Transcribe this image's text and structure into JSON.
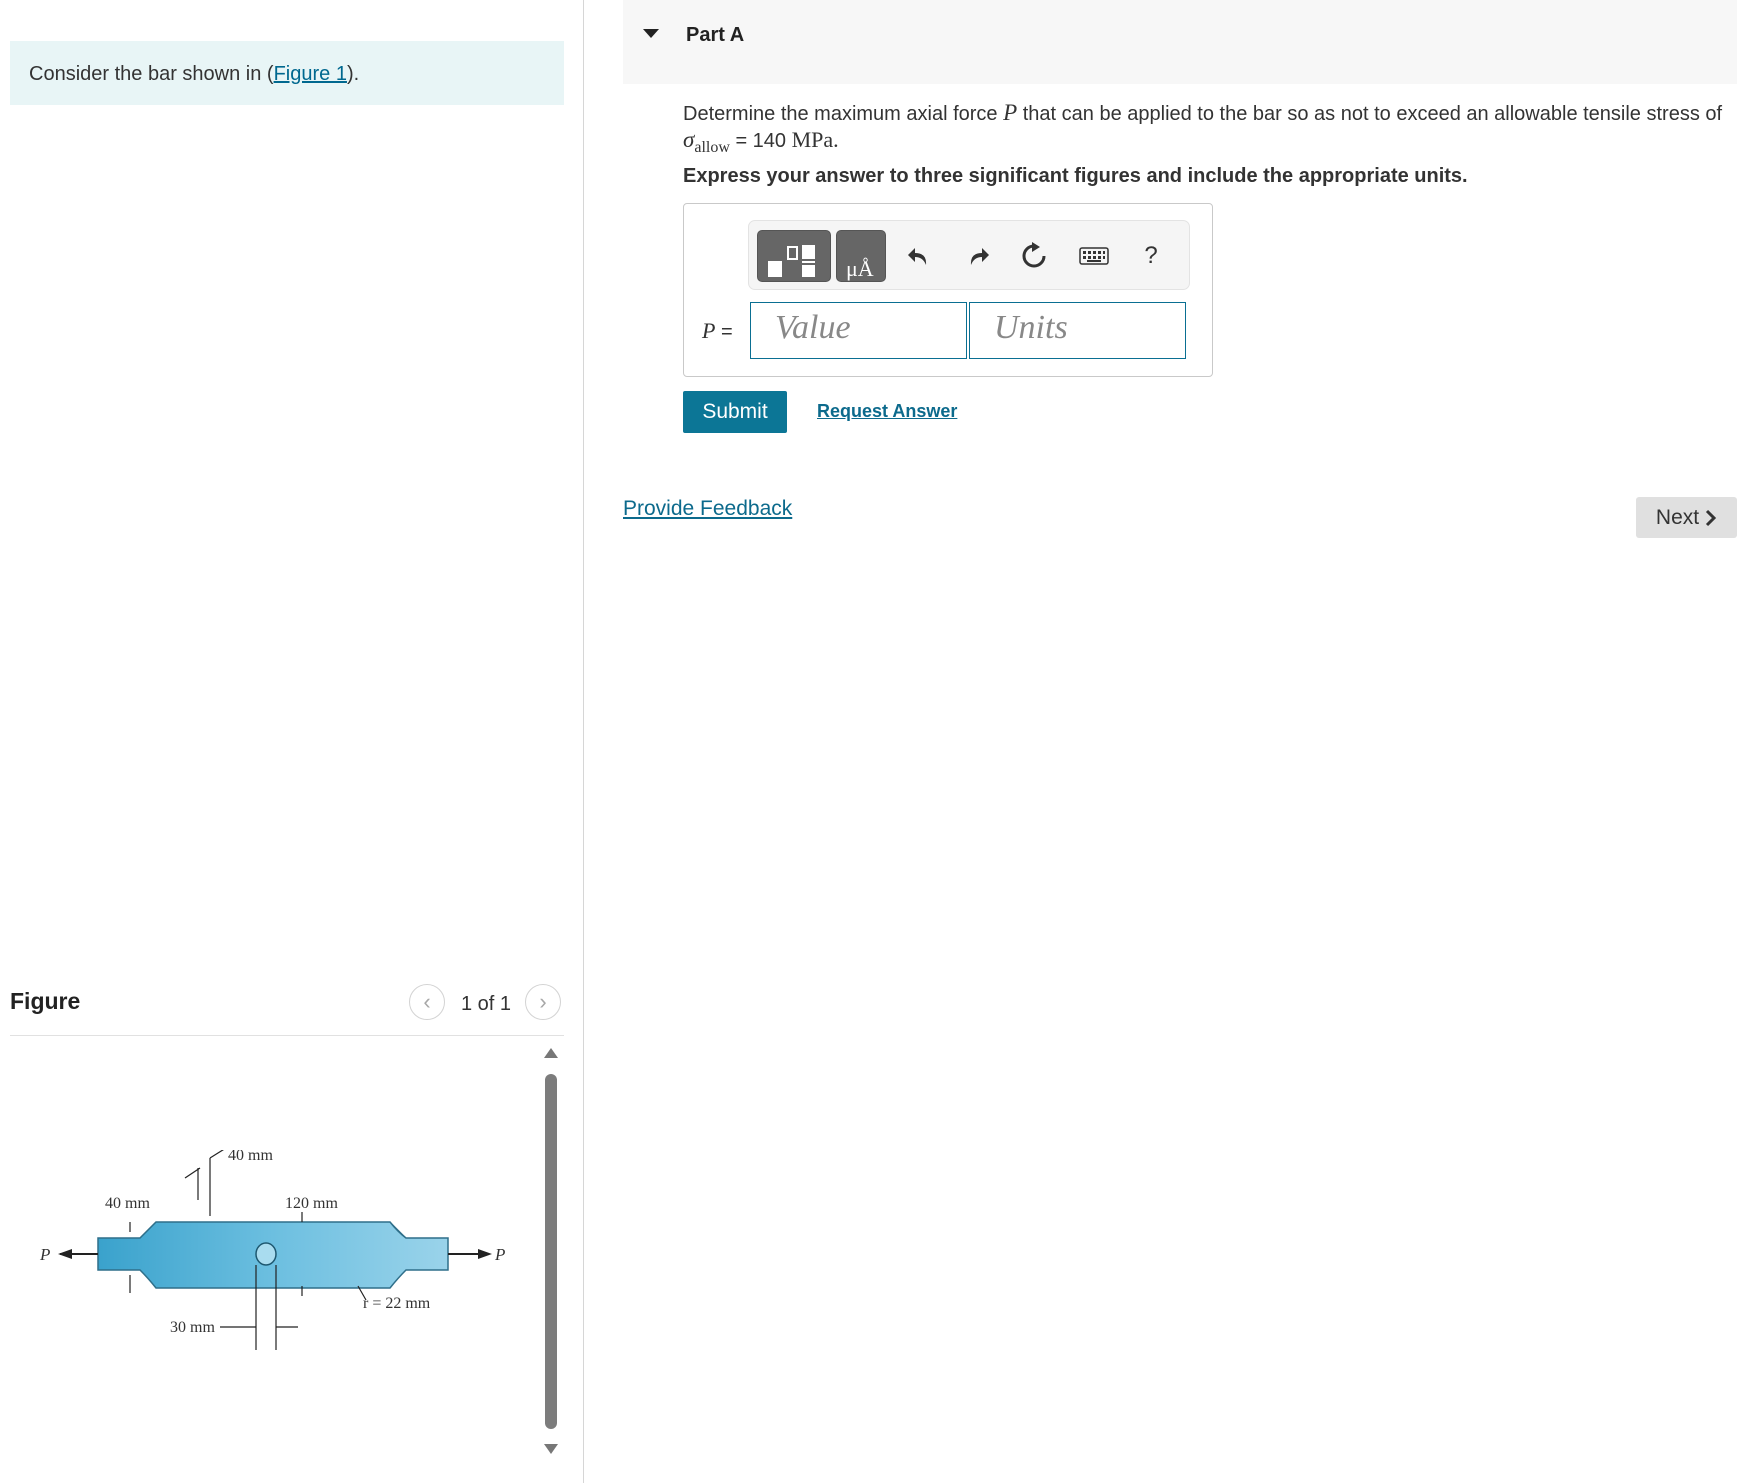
{
  "intro": {
    "prefix": "Consider the bar shown in (",
    "figure_link": "Figure 1",
    "suffix": ")."
  },
  "figure_panel": {
    "title": "Figure",
    "pager_count": "1 of 1",
    "labels": {
      "left_width": "40 mm",
      "top_width": "40 mm",
      "length": "120 mm",
      "hole": "30 mm",
      "radius": "r = 22 mm",
      "force_left": "P",
      "force_right": "P"
    },
    "bar_color": "#5bb4d6"
  },
  "part": {
    "title": "Part A"
  },
  "question": {
    "text_before": "Determine the maximum axial force ",
    "var_P": "P",
    "text_middle": " that can be applied to the bar so as not to exceed an allowable tensile stress of",
    "sigma": "σ",
    "sigma_sub": "allow",
    "equals": " = 140 ",
    "unit": "MPa",
    "period": ".",
    "instruction": "Express your answer to three significant figures and include the appropriate units."
  },
  "answer": {
    "label_var": "P",
    "label_eq": " =",
    "value_placeholder": "Value",
    "units_placeholder": "Units",
    "toolbar": {
      "units_glyph": "μÅ",
      "help_glyph": "?"
    }
  },
  "actions": {
    "submit_label": "Submit",
    "request_answer_label": "Request Answer",
    "provide_feedback_label": "Provide Feedback",
    "next_label": "Next"
  },
  "colors": {
    "accent": "#0c7696",
    "link": "#0c6a8c",
    "intro_bg": "#e8f5f6"
  }
}
